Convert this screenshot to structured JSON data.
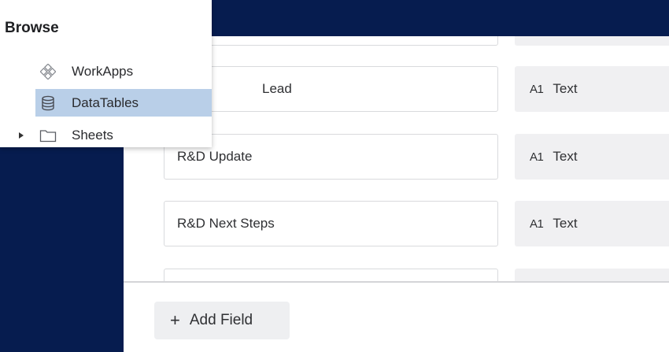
{
  "browse": {
    "title": "Browse",
    "items": [
      {
        "label": "WorkApps",
        "icon": "workapps-icon",
        "selected": false
      },
      {
        "label": "DataTables",
        "icon": "database-icon",
        "selected": true
      },
      {
        "label": "Sheets",
        "icon": "folder-icon",
        "selected": false
      }
    ]
  },
  "fields": {
    "rows": [
      {
        "name": "",
        "type": ""
      },
      {
        "name": "Lead",
        "type_icon": "A1",
        "type": "Text"
      },
      {
        "name": "R&D Update",
        "type_icon": "A1",
        "type": "Text"
      },
      {
        "name": "R&D Next Steps",
        "type_icon": "A1",
        "type": "Text"
      },
      {
        "name": "",
        "type": ""
      }
    ]
  },
  "footer": {
    "add_field_icon": "+",
    "add_field_label": "Add Field"
  },
  "colors": {
    "background": "#061c4f",
    "selected": "#b9cfe8"
  }
}
